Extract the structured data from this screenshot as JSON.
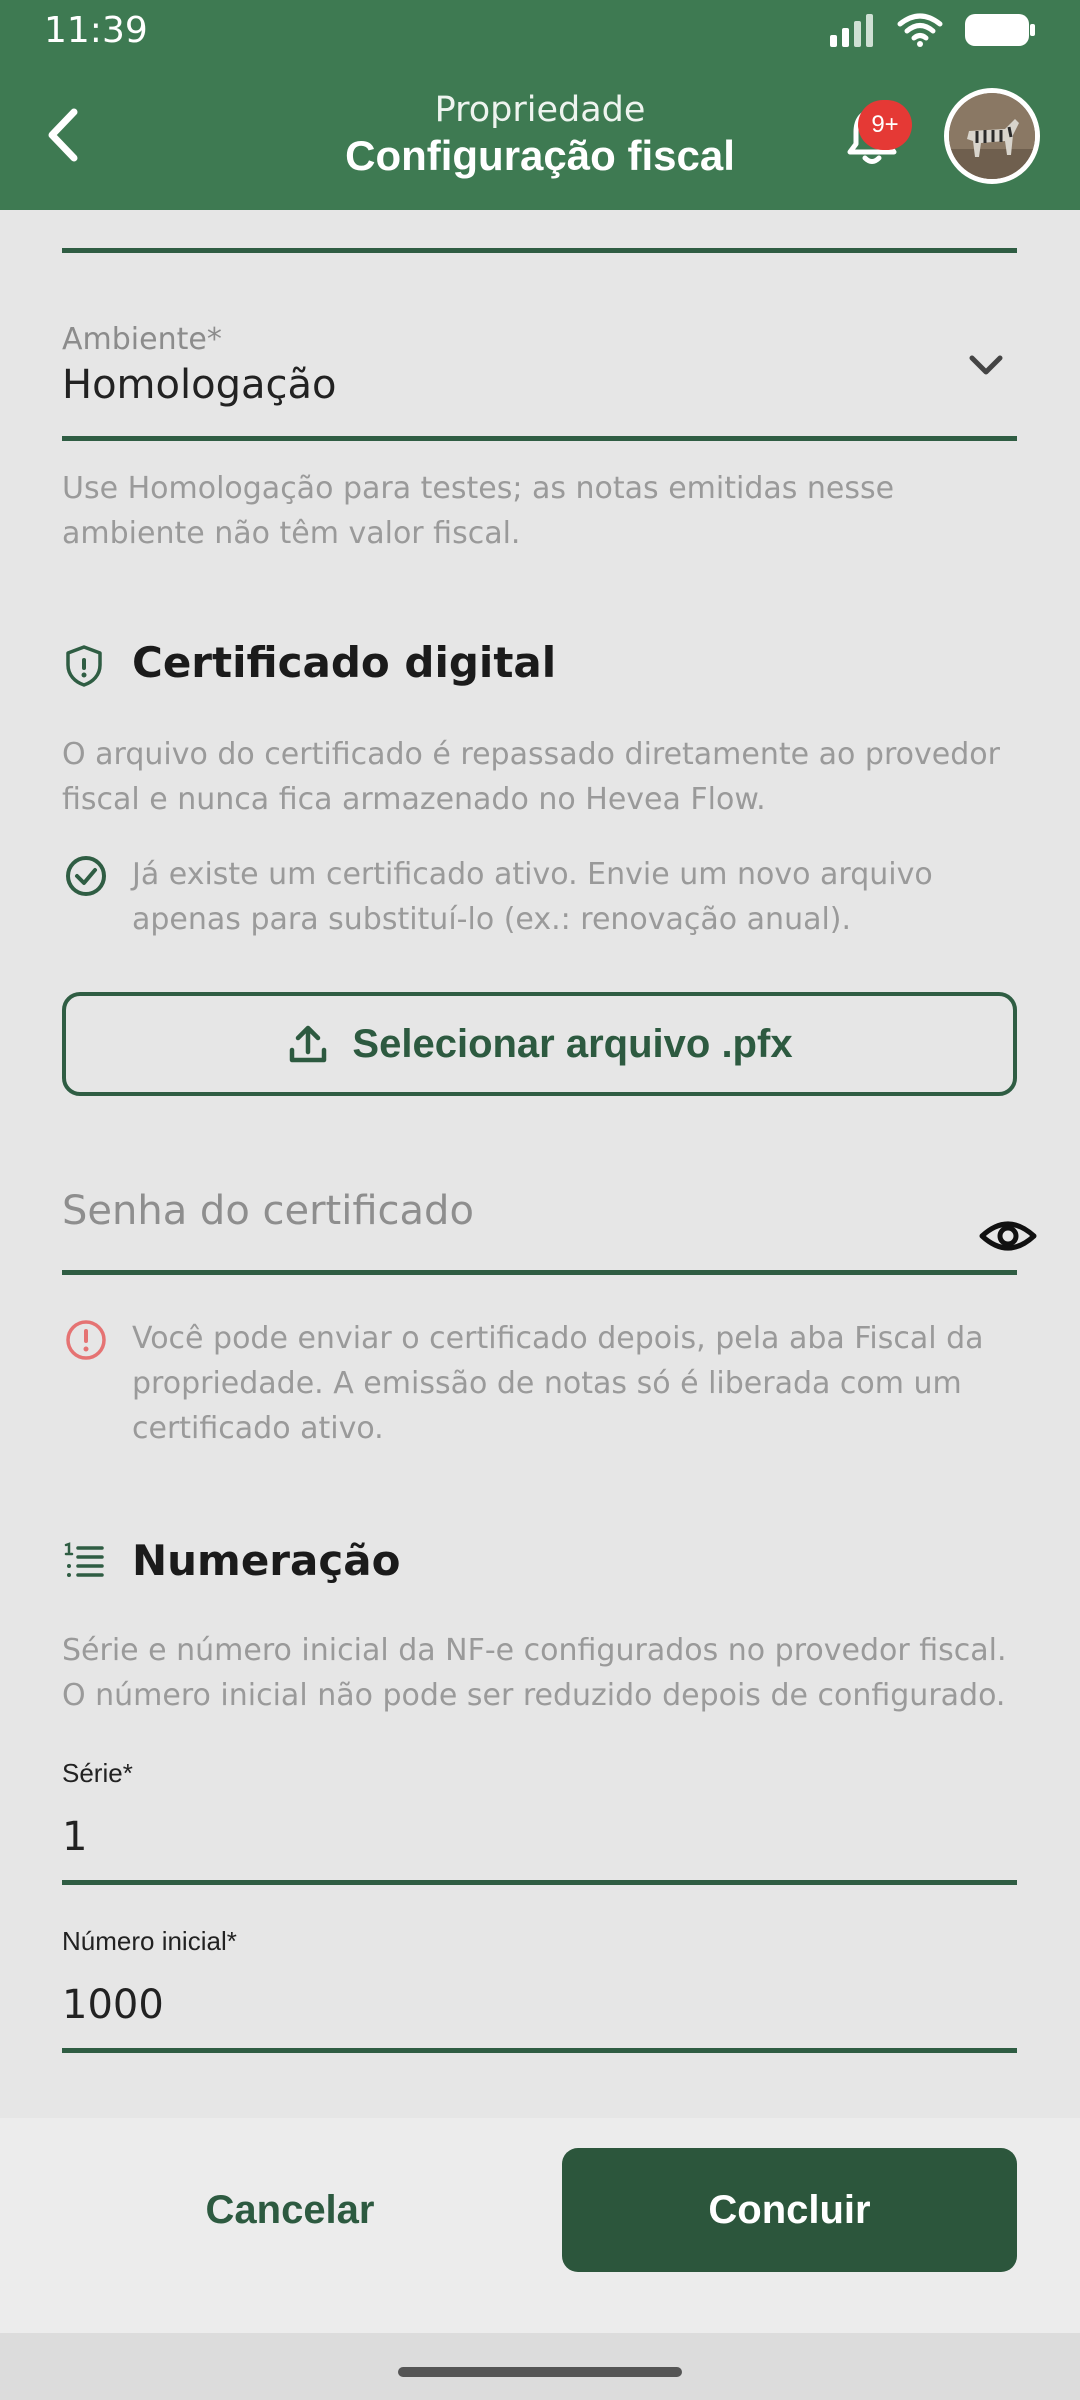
{
  "status_bar": {
    "time": "11:39"
  },
  "header": {
    "subtitle": "Propriedade",
    "title": "Configuração fiscal",
    "notification_badge": "9+"
  },
  "environment_field": {
    "label": "Ambiente*",
    "value": "Homologação",
    "helper": "Use Homologação para testes; as notas emitidas nesse ambiente não têm valor fiscal."
  },
  "certificate": {
    "title": "Certificado digital",
    "description": "O arquivo do certificado é repassado diretamente ao provedor fiscal e nunca fica armazenado no Hevea Flow.",
    "active_notice": "Já existe um certificado ativo. Envie um novo arquivo apenas para substituí-lo (ex.: renovação anual).",
    "upload_label": "Selecionar arquivo .pfx",
    "password_placeholder": "Senha do certificado",
    "warning": "Você pode enviar o certificado depois, pela aba Fiscal da propriedade. A emissão de notas só é liberada com um certificado ativo."
  },
  "numbering": {
    "title": "Numeração",
    "description": "Série e número inicial da NF-e configurados no provedor fiscal. O número inicial não pode ser reduzido depois de configurado.",
    "series_label": "Série*",
    "series_value": "1",
    "start_label": "Número inicial*",
    "start_value": "1000"
  },
  "actions": {
    "cancel": "Cancelar",
    "done": "Concluir"
  },
  "colors": {
    "header_bg": "#3e7a52",
    "accent": "#2f5d43",
    "primary_button": "#2c563c",
    "badge": "#e53935",
    "warning_icon": "#e57373"
  },
  "icons": {
    "back": "chevron-left-icon",
    "bell": "bell-icon",
    "shield": "shield-icon",
    "check": "check-circle-icon",
    "upload": "upload-icon",
    "eye": "eye-icon",
    "info": "info-icon",
    "list": "list-numbered-icon",
    "dropdown": "chevron-down-icon"
  }
}
